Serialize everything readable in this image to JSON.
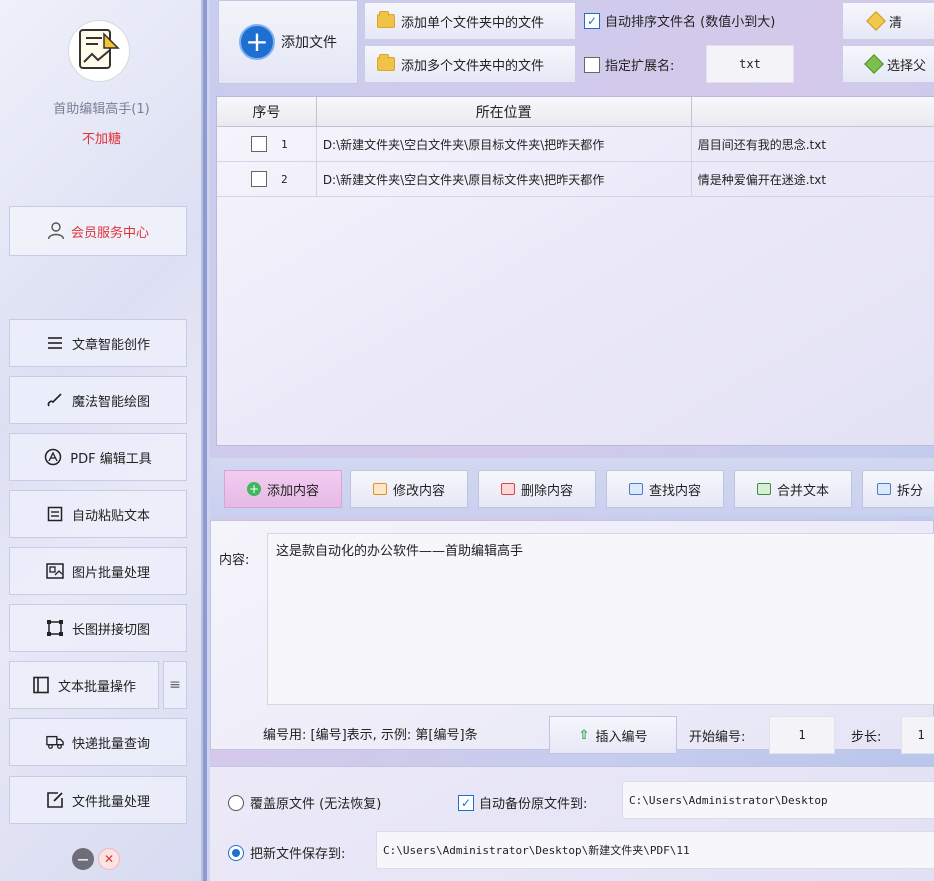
{
  "sidebar": {
    "app_name": "首助编辑高手(1)",
    "app_sub": "不加糖",
    "member_center": "会员服务中心",
    "nav": [
      {
        "label": "文章智能创作",
        "icon": "menu-lines-icon"
      },
      {
        "label": "魔法智能绘图",
        "icon": "brush-icon"
      },
      {
        "label": "PDF 编辑工具",
        "icon": "pdf-icon"
      },
      {
        "label": "自动粘贴文本",
        "icon": "paste-icon"
      },
      {
        "label": "图片批量处理",
        "icon": "image-icon"
      },
      {
        "label": "长图拼接切图",
        "icon": "crop-icon"
      },
      {
        "label": "文本批量操作",
        "icon": "text-doc-icon"
      },
      {
        "label": "快递批量查询",
        "icon": "truck-icon"
      },
      {
        "label": "文件批量处理",
        "icon": "file-edit-icon"
      }
    ],
    "more_glyph": "≡",
    "min_glyph": "—",
    "close_glyph": "✕"
  },
  "toolbar": {
    "add_file": "添加文件",
    "add_single_folder": "添加单个文件夹中的文件",
    "add_multi_folder": "添加多个文件夹中的文件",
    "auto_sort_label": "自动排序文件名 (数值小到大)",
    "auto_sort_checked": true,
    "ext_label": "指定扩展名:",
    "ext_checked": false,
    "ext_value": "txt",
    "right_top": "清",
    "right_bottom": "选择父"
  },
  "table": {
    "headers": [
      "序号",
      "所在位置",
      ""
    ],
    "rows": [
      {
        "index": "1",
        "location": "D:\\新建文件夹\\空白文件夹\\原目标文件夹\\把昨天都作",
        "name": "眉目间还有我的思念.txt"
      },
      {
        "index": "2",
        "location": "D:\\新建文件夹\\空白文件夹\\原目标文件夹\\把昨天都作",
        "name": "情是种爱偏开在迷途.txt"
      }
    ]
  },
  "actions": {
    "add_content": "添加内容",
    "modify_content": "修改内容",
    "delete_content": "删除内容",
    "find_content": "查找内容",
    "merge_text": "合并文本",
    "split": "拆分"
  },
  "content": {
    "label": "内容:",
    "value": "这是款自动化的办公软件——首助编辑高手",
    "number_hint": "编号用: [编号]表示, 示例: 第[编号]条",
    "insert_number": "插入编号",
    "start_label": "开始编号:",
    "start_value": "1",
    "step_label": "步长:",
    "step_value": "1"
  },
  "output": {
    "overwrite_label": "覆盖原文件 (无法恢复)",
    "overwrite_selected": false,
    "backup_label": "自动备份原文件到:",
    "backup_checked": true,
    "backup_path": "C:\\Users\\Administrator\\Desktop",
    "save_new_label": "把新文件保存到:",
    "save_new_selected": true,
    "save_path": "C:\\Users\\Administrator\\Desktop\\新建文件夹\\PDF\\11"
  }
}
